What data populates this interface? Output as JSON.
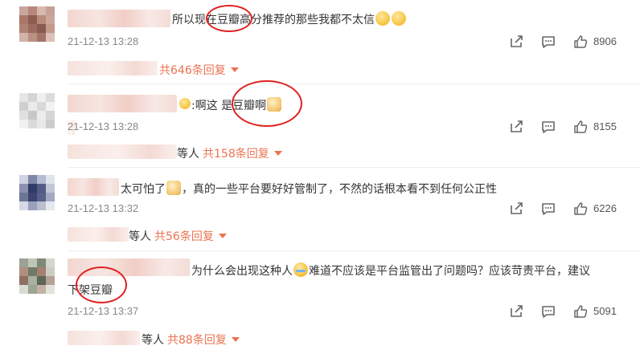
{
  "comments": [
    {
      "text_before": "所以现在",
      "highlight": "豆瓣",
      "text_after": "高分推荐的那些我都不太信",
      "time": "21-12-13 13:28",
      "likes": "8906",
      "reply_link": "共646条回复",
      "reply_suffix": ""
    },
    {
      "text_before": ":啊这 是",
      "highlight": "豆瓣",
      "text_after": "啊",
      "time": "21-12-13 13:28",
      "likes": "8155",
      "reply_link": "共158条回复",
      "reply_suffix": "等人"
    },
    {
      "text_before": "太可怕了",
      "highlight": "",
      "text_after": "，真的一些平台要好好管制了，不然的话根本看不到任何公正性",
      "time": "21-12-13 13:32",
      "likes": "6226",
      "reply_link": "共56条回复",
      "reply_suffix": "等人"
    },
    {
      "text_before": "为什么会出现这种人",
      "highlight": "",
      "text_after": "难道不应该是平台监管出了问题吗？应该苛责平台，建议",
      "line2_prefix": "下架",
      "line2_highlight": "豆瓣",
      "time": "21-12-13 13:37",
      "likes": "5091",
      "reply_link": "共88条回复",
      "reply_suffix": "等人"
    }
  ],
  "icons": {
    "share": "share-icon",
    "comment": "comment-icon",
    "like": "thumbs-up-icon",
    "reply_dropdown": "chevron-down-icon"
  },
  "colors": {
    "accent": "#eb7350",
    "annotation": "#e02020",
    "meta": "#888888"
  }
}
